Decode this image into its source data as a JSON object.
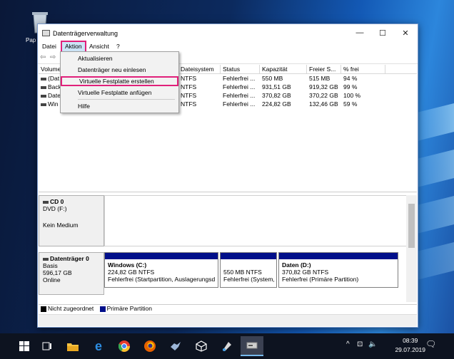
{
  "desktop": {
    "icon_label": "Pap"
  },
  "window": {
    "title": "Datenträgerverwaltung",
    "controls": {
      "minimize": "—",
      "maximize": "☐",
      "close": "✕"
    }
  },
  "menubar": {
    "items": [
      "Datei",
      "Aktion",
      "Ansicht",
      "?"
    ],
    "active": "Aktion"
  },
  "toolbar": {
    "back": "⇦",
    "forward": "⇨"
  },
  "dropdown": {
    "items": [
      "Aktualisieren",
      "Datenträger neu einlesen",
      "Virtuelle Festplatte erstellen",
      "Virtuelle Festplatte anfügen",
      "Hilfe"
    ],
    "highlighted": "Virtuelle Festplatte erstellen"
  },
  "volumes": {
    "headers": [
      "Volume",
      "Dateisystem",
      "Status",
      "Kapazität",
      "Freier S...",
      "% frei"
    ],
    "rows": [
      {
        "name": "(Dat",
        "fs": "NTFS",
        "status": "Fehlerfrei ...",
        "capacity": "550 MB",
        "free": "515 MB",
        "pct": "94 %"
      },
      {
        "name": "Back",
        "fs": "NTFS",
        "status": "Fehlerfrei ...",
        "capacity": "931,51 GB",
        "free": "919,32 GB",
        "pct": "99 %"
      },
      {
        "name": "Date",
        "fs": "NTFS",
        "status": "Fehlerfrei ...",
        "capacity": "370,82 GB",
        "free": "370,22 GB",
        "pct": "100 %"
      },
      {
        "name": "Win",
        "fs": "NTFS",
        "status": "Fehlerfrei ...",
        "capacity": "224,82 GB",
        "free": "132,46 GB",
        "pct": "59 %"
      }
    ]
  },
  "disks": [
    {
      "name": "CD 0",
      "line1": "DVD (F:)",
      "line2": "",
      "line3": "Kein Medium"
    },
    {
      "name": "Datenträger 0",
      "line1": "Basis",
      "line2": "596,17 GB",
      "line3": "Online"
    }
  ],
  "partitions": [
    {
      "title": "Windows (C:)",
      "size": "224,82 GB NTFS",
      "status": "Fehlerfrei (Startpartition, Auslagerungsd"
    },
    {
      "title": "",
      "size": "550 MB NTFS",
      "status": "Fehlerfrei (System,"
    },
    {
      "title": "Daten (D:)",
      "size": "370,82 GB NTFS",
      "status": "Fehlerfrei (Primäre Partition)"
    }
  ],
  "legend": {
    "unallocated": "Nicht zugeordnet",
    "primary": "Primäre Partition",
    "unallocated_color": "#000000",
    "primary_color": "#000f8a"
  },
  "taskbar": {
    "time": "08:39",
    "date": "29.07.2019",
    "icons": [
      "windows-start",
      "task-view",
      "file-explorer",
      "edge",
      "chrome",
      "firefox",
      "app-bird",
      "app-cube",
      "app-paint",
      "disk-management"
    ],
    "tray": {
      "chevron": "^",
      "network": "⊡",
      "volume": "🔈",
      "notifications": "🗨"
    }
  }
}
